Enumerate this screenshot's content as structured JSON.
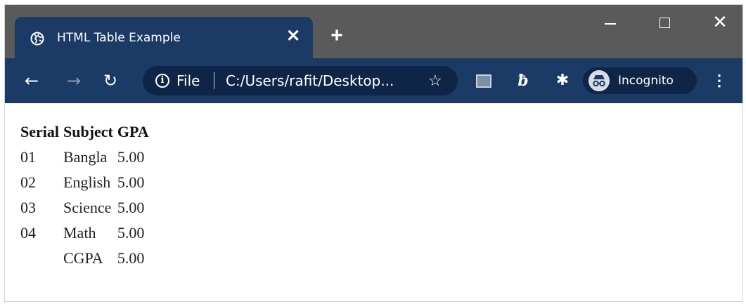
{
  "browser": {
    "tab_title": "HTML Table Example",
    "tab_close_glyph": "✕",
    "new_tab_glyph": "+",
    "omnibox": {
      "scheme_label": "File",
      "url": "C:/Users/rafit/Desktop...",
      "info_glyph": "i",
      "star_glyph": "☆"
    },
    "profile_label": "Incognito",
    "nav": {
      "back_glyph": "←",
      "forward_glyph": "→",
      "reload_glyph": "↻"
    },
    "menu_glyph": "⋮",
    "colors": {
      "titlebar": "#5a5a5a",
      "toolbar": "#1b3a66",
      "omnibox": "#0e2547"
    }
  },
  "icons": {
    "tab": "globe-icon",
    "window": [
      "minimize-icon",
      "maximize-icon",
      "close-icon"
    ],
    "toolbar": [
      "back-arrow-icon",
      "forward-arrow-icon",
      "reload-icon",
      "info-icon",
      "star-icon",
      "image-extension-icon",
      "b-extension-icon",
      "puzzle-extension-icon",
      "incognito-icon",
      "kebab-menu-icon"
    ]
  },
  "table": {
    "headers": [
      "Serial",
      "Subject",
      "GPA"
    ],
    "rows": [
      [
        "01",
        "Bangla",
        "5.00"
      ],
      [
        "02",
        "English",
        "5.00"
      ],
      [
        "03",
        "Science",
        "5.00"
      ],
      [
        "04",
        "Math",
        "5.00"
      ],
      [
        "",
        "CGPA",
        "5.00"
      ]
    ]
  }
}
